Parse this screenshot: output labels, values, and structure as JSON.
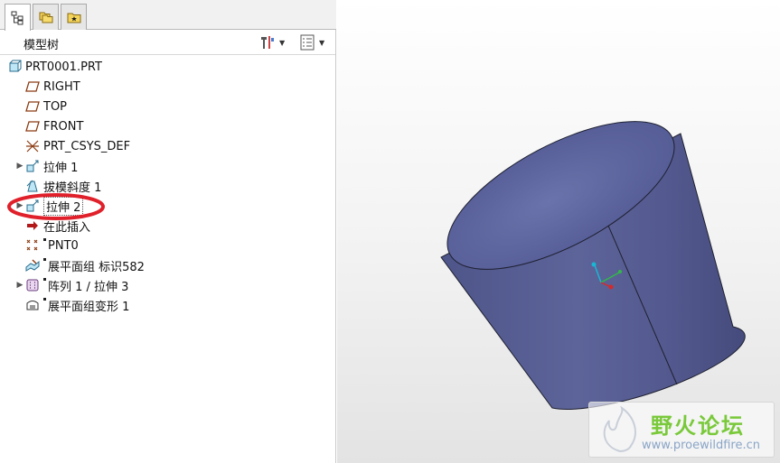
{
  "panel": {
    "tabs": [
      {
        "name": "model-tree",
        "icon": "tree-icon"
      },
      {
        "name": "folder-browser",
        "icon": "folders-icon"
      },
      {
        "name": "favorites",
        "icon": "star-folder-icon"
      }
    ],
    "title": "模型树",
    "tools": {
      "settings_icon": "tools-icon",
      "show_icon": "list-icon"
    }
  },
  "tree": {
    "items": [
      {
        "label": "PRT0001.PRT",
        "icon": "part-icon"
      },
      {
        "label": "RIGHT",
        "icon": "datum-plane-icon"
      },
      {
        "label": "TOP",
        "icon": "datum-plane-icon"
      },
      {
        "label": "FRONT",
        "icon": "datum-plane-icon"
      },
      {
        "label": "PRT_CSYS_DEF",
        "icon": "csys-icon"
      },
      {
        "label": "拉伸 1",
        "icon": "extrude-icon"
      },
      {
        "label": "拔模斜度 1",
        "icon": "draft-icon"
      },
      {
        "label": "拉伸 2",
        "icon": "extrude-icon"
      },
      {
        "label": "在此插入",
        "icon": "insert-arrow-icon"
      },
      {
        "label": "PNT0",
        "icon": "datum-point-icon"
      },
      {
        "label": "展平面组 标识582",
        "icon": "flatten-quilt-icon"
      },
      {
        "label": "阵列 1 / 拉伸 3",
        "icon": "pattern-icon"
      },
      {
        "label": "展平面组变形 1",
        "icon": "flatten-deform-icon"
      }
    ]
  },
  "watermark": {
    "main": "野火论坛",
    "sub": "www.proewildfire.cn"
  },
  "colors": {
    "solid": "#50588f",
    "highlight": "#e0202a",
    "watermark_green": "#79c93a"
  }
}
